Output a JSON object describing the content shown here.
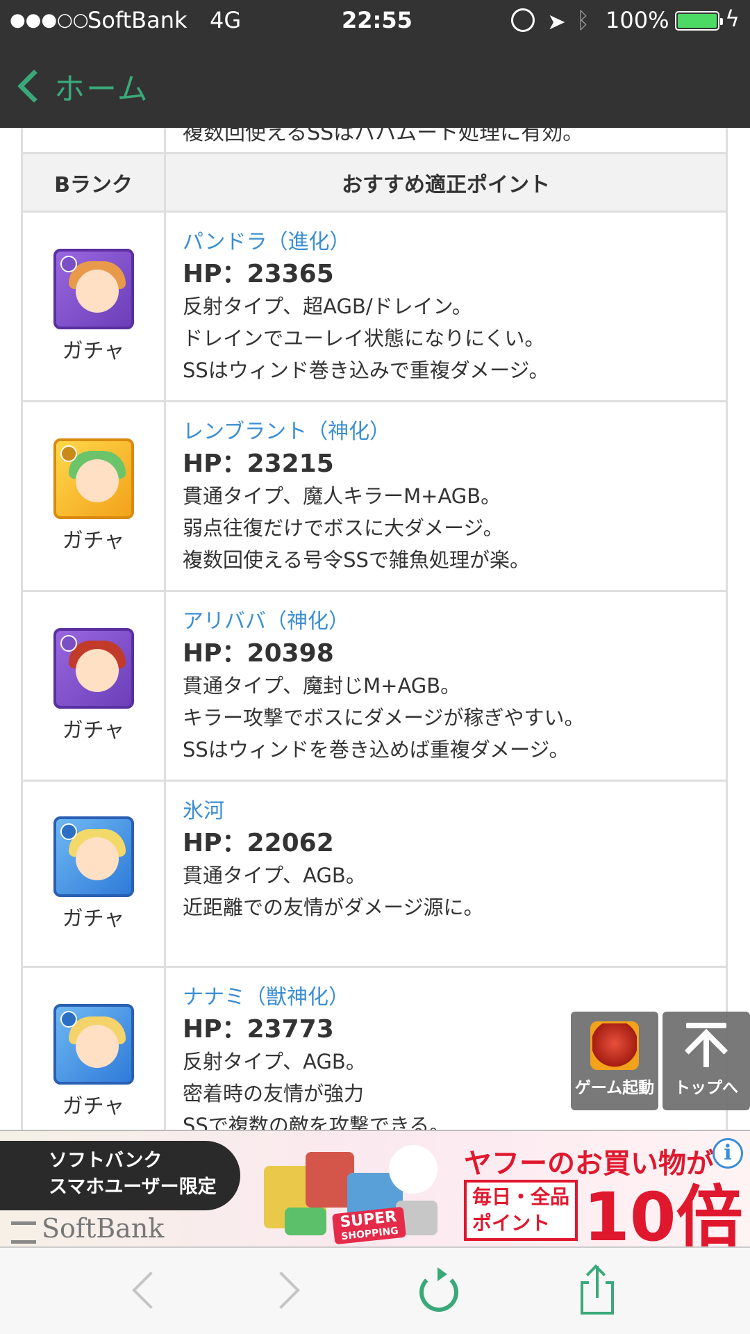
{
  "status_bar": {
    "signal": "●●●○○",
    "carrier": "SoftBank",
    "network": "4G",
    "time": "22:55",
    "battery_percent": "100%",
    "battery_level": 1.0,
    "icons": [
      "orientation-lock-icon",
      "location-arrow-icon",
      "bluetooth-icon",
      "battery-icon",
      "charging-bolt-icon"
    ]
  },
  "nav": {
    "back_label": "ホーム"
  },
  "table": {
    "cut_text": "複数回使えるSSはバハムート処理に有効。",
    "header": {
      "rank": "Bランク",
      "points": "おすすめ適正ポイント"
    },
    "rows": [
      {
        "name": "パンドラ（進化）",
        "hp": "HP：23365",
        "source": "ガチャ",
        "avatar_color": "purple",
        "lines": [
          "反射タイプ、超AGB/ドレイン。",
          "ドレインでユーレイ状態になりにくい。",
          "SSはウィンド巻き込みで重複ダメージ。"
        ]
      },
      {
        "name": "レンブラント（神化）",
        "hp": "HP：23215",
        "source": "ガチャ",
        "avatar_color": "yellow",
        "lines": [
          "貫通タイプ、魔人キラーM+AGB。",
          "弱点往復だけでボスに大ダメージ。",
          "複数回使える号令SSで雑魚処理が楽。"
        ]
      },
      {
        "name": "アリババ（神化）",
        "hp": "HP：20398",
        "source": "ガチャ",
        "avatar_color": "purple",
        "lines": [
          "貫通タイプ、魔封じM+AGB。",
          "キラー攻撃でボスにダメージが稼ぎやすい。",
          "SSはウィンドを巻き込めば重複ダメージ。"
        ]
      },
      {
        "name": "氷河",
        "hp": "HP：22062",
        "source": "ガチャ",
        "avatar_color": "blue",
        "lines": [
          "貫通タイプ、AGB。",
          "近距離での友情がダメージ源に。"
        ]
      },
      {
        "name": "ナナミ（獣神化）",
        "hp": "HP：23773",
        "source": "ガチャ",
        "avatar_color": "blue",
        "lines": [
          "反射タイプ、AGB。",
          "密着時の友情が強力",
          "SSで複数の敵を攻撃できる。"
        ]
      }
    ]
  },
  "floating": {
    "game_label": "ゲーム起動",
    "top_label": "トップへ"
  },
  "ad": {
    "left_line1": "ソフトバンク",
    "left_line2": "スマホユーザー限定",
    "brand": "SoftBank",
    "super_line1": "SUPER",
    "super_line2": "SHOPPING",
    "title": "ヤフーのお買い物が",
    "box_line1": "毎日・全品",
    "box_line2": "ポイント",
    "big": "10倍",
    "info": "i"
  },
  "toolbar": {
    "icons": [
      "back-icon",
      "forward-icon",
      "reload-icon",
      "share-icon"
    ]
  },
  "colors": {
    "accent_green": "#3aa979",
    "link_blue": "#3b8ed4",
    "header_bg": "#333333",
    "ad_red": "#e0182e"
  }
}
